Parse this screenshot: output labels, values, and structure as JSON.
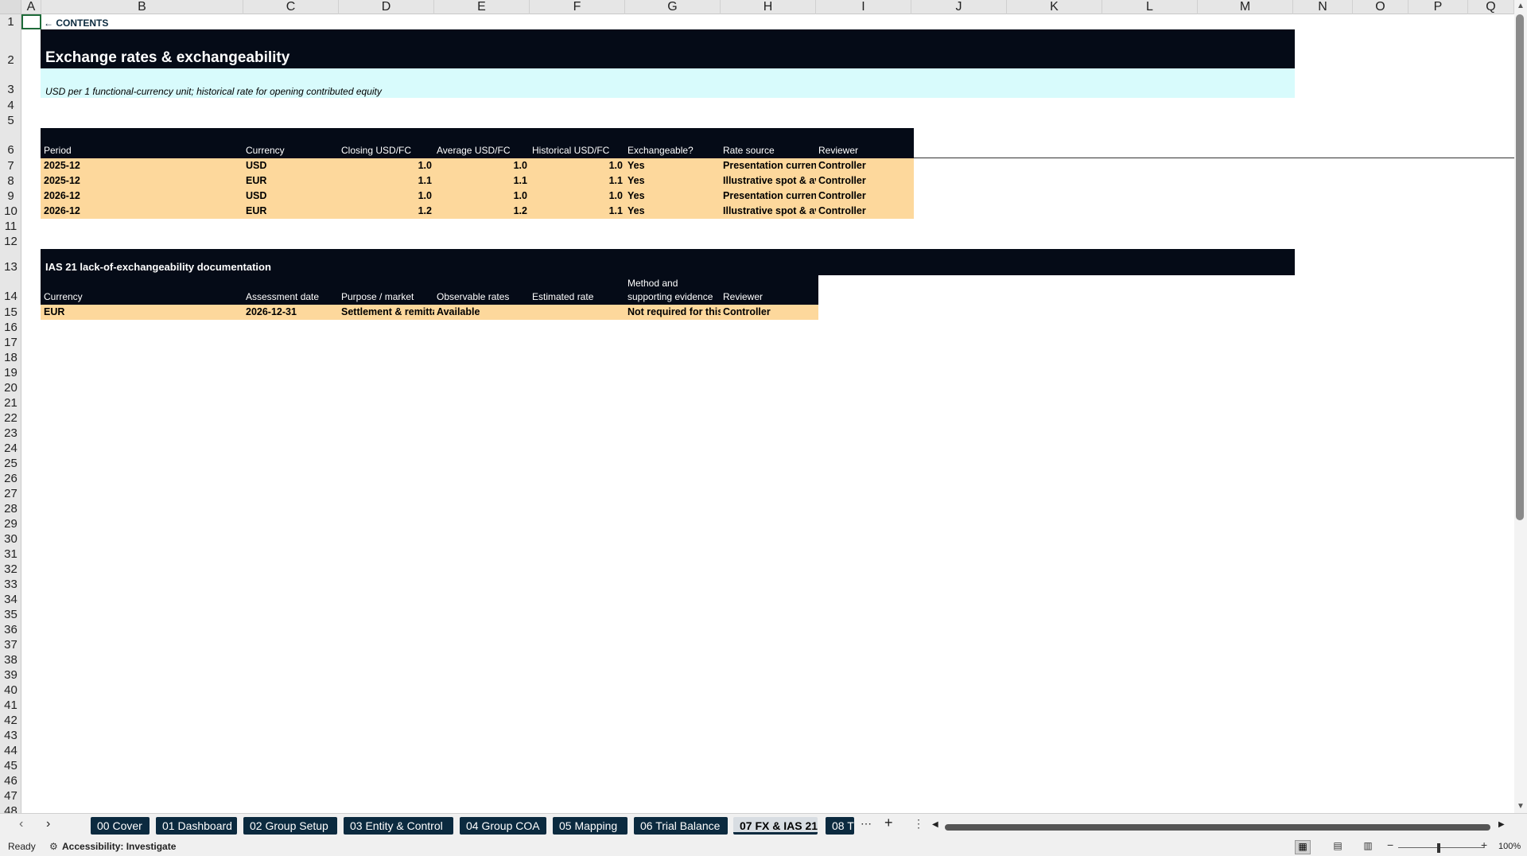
{
  "columns": [
    "A",
    "B",
    "C",
    "D",
    "E",
    "F",
    "G",
    "H",
    "I",
    "J",
    "K",
    "L",
    "M",
    "N",
    "O",
    "P",
    "Q"
  ],
  "rows": [
    "1",
    "2",
    "3",
    "4",
    "5",
    "6",
    "7",
    "8",
    "9",
    "10",
    "11",
    "12",
    "13",
    "14",
    "15",
    "16",
    "17",
    "18",
    "19",
    "20",
    "21",
    "22",
    "23",
    "24",
    "25",
    "26",
    "27",
    "28",
    "29",
    "30",
    "31",
    "32",
    "33",
    "34",
    "35",
    "36",
    "37",
    "38",
    "39",
    "40",
    "41",
    "42",
    "43",
    "44",
    "45",
    "46",
    "47",
    "48"
  ],
  "contents_link": "← CONTENTS",
  "title": "Exchange rates & exchangeability",
  "subtitle": "USD per 1 functional-currency unit; historical rate for opening contributed equity",
  "fx_table": {
    "headers": [
      "Period",
      "Currency",
      "Closing USD/FC",
      "Average USD/FC",
      "Historical USD/FC",
      "Exchangeable?",
      "Rate source",
      "Reviewer"
    ],
    "rows": [
      [
        "2025-12",
        "USD",
        "1.0",
        "1.0",
        "1.0",
        "Yes",
        "Presentation currenc",
        "Controller"
      ],
      [
        "2025-12",
        "EUR",
        "1.1",
        "1.1",
        "1.1",
        "Yes",
        "Illustrative spot & av",
        "Controller"
      ],
      [
        "2026-12",
        "USD",
        "1.0",
        "1.0",
        "1.0",
        "Yes",
        "Presentation currenc",
        "Controller"
      ],
      [
        "2026-12",
        "EUR",
        "1.2",
        "1.2",
        "1.1",
        "Yes",
        "Illustrative spot & av",
        "Controller"
      ]
    ]
  },
  "ias_section": {
    "title": "IAS 21 lack-of-exchangeability documentation",
    "headers": [
      "Currency",
      "Assessment date",
      "Purpose / market",
      "Observable rates",
      "Estimated rate",
      "Method and",
      "supporting evidence",
      "Reviewer"
    ],
    "row": [
      "EUR",
      "2026-12-31",
      "Settlement & remitta",
      "Available",
      "",
      "Not required for this",
      "Controller"
    ]
  },
  "sheet_tabs": [
    "00 Cover",
    "01 Dashboard",
    "02 Group Setup",
    "03 Entity & Control",
    "04 Group COA",
    "05 Mapping",
    "06 Trial Balance",
    "07 FX & IAS 21",
    "08 T"
  ],
  "active_tab": "07 FX & IAS 21",
  "status": {
    "ready": "Ready",
    "accessibility": "Accessibility: Investigate",
    "zoom": "100%"
  }
}
